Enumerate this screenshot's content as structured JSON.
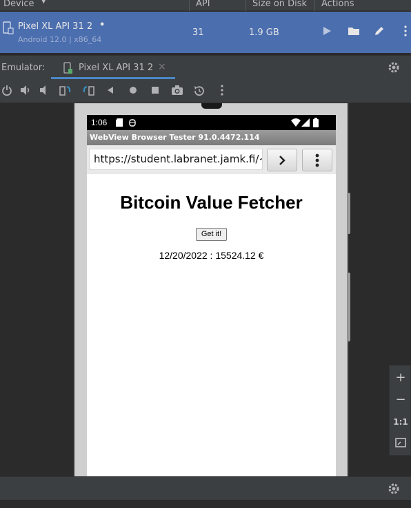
{
  "device_manager": {
    "columns": [
      "Device",
      "API",
      "Size on Disk",
      "Actions"
    ],
    "device": {
      "name": "Pixel XL API 31 2",
      "status_dot": "•",
      "subtitle": "Android 12.0 | x86_64",
      "api": "31",
      "size": "1.9 GB"
    },
    "actions": [
      "play-icon",
      "folder-icon",
      "edit-icon",
      "more-icon"
    ]
  },
  "emulator": {
    "label": "Emulator:",
    "tab_label": "Pixel XL API 31 2",
    "close_glyph": "×"
  },
  "toolbar": {
    "icons": [
      "power-icon",
      "volume-up-icon",
      "volume-down-icon",
      "rotate-left-icon",
      "rotate-right-icon",
      "back-icon",
      "home-icon",
      "overview-icon",
      "camera-icon",
      "snapshot-icon",
      "more-icon"
    ]
  },
  "phone": {
    "status_time": "1:06",
    "app_title": "WebView Browser Tester 91.0.4472.114",
    "url": "https://student.labranet.jamk.fi/~a",
    "go_glyph": "›",
    "menu_glyph": "⋮",
    "page": {
      "title": "Bitcoin Value Fetcher",
      "button_label": "Get it!",
      "result": "12/20/2022 : 15524.12 €"
    }
  },
  "zoom_panel": {
    "plus": "+",
    "minus": "−",
    "one_to_one": "1:1",
    "fit": "⤢"
  },
  "colors": {
    "selection": "#4b6eaf",
    "tab_underline": "#4a88c7",
    "ide_background": "#2b2b2b"
  }
}
